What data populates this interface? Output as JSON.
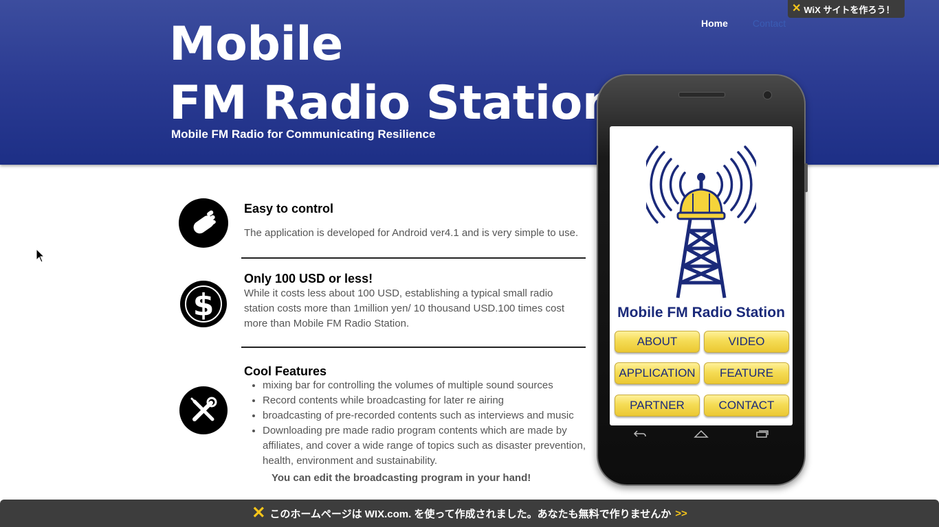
{
  "header": {
    "title_line1": "Mobile",
    "title_line2": "FM Radio Station",
    "tagline": "Mobile FM Radio for Communicating Resilience",
    "nav": [
      {
        "label": "Home",
        "active": true
      },
      {
        "label": "Contact",
        "active": false
      }
    ],
    "wix_badge": "WiX サイトを作ろう！"
  },
  "features": [
    {
      "title": "Easy to control",
      "text": "The application is developed for Android ver4.1 and is very simple to use.",
      "icon": "hand-icon"
    },
    {
      "title": "Only 100 USD or less!",
      "text": "While it costs less about 100 USD, establishing a typical small radio station costs more than 1million yen/ 10 thousand USD.100 times cost more than Mobile FM Radio Station.",
      "icon": "dollar-icon"
    },
    {
      "title": "Cool Features",
      "icon": "tools-icon",
      "items": [
        "mixing bar for controlling the volumes of multiple sound sources",
        "Record contents while broadcasting for later re airing",
        "broadcasting of pre-recorded contents such as interviews and music",
        "Downloading pre made radio program contents which are made by affiliates, and cover a wide range of topics such as disaster prevention, health, environment and sustainability."
      ]
    }
  ],
  "closing_text": "You can edit the broadcasting program in your hand!",
  "phone_app": {
    "title": "Mobile FM Radio Station",
    "buttons": [
      "ABOUT",
      "VIDEO",
      "APPLICATION",
      "FEATURE",
      "PARTNER",
      "CONTACT"
    ],
    "colors": {
      "accent": "#1b2a7a",
      "button": "#f5dc55"
    }
  },
  "footer": {
    "text": "このホームページは WIX.com. を使って作成されました。あなたも無料で作りませんか",
    "arrow": ">>"
  },
  "colors": {
    "header": "#2b3b92",
    "footer": "#3d3d3d",
    "wix_yellow": "#f5c51a"
  }
}
